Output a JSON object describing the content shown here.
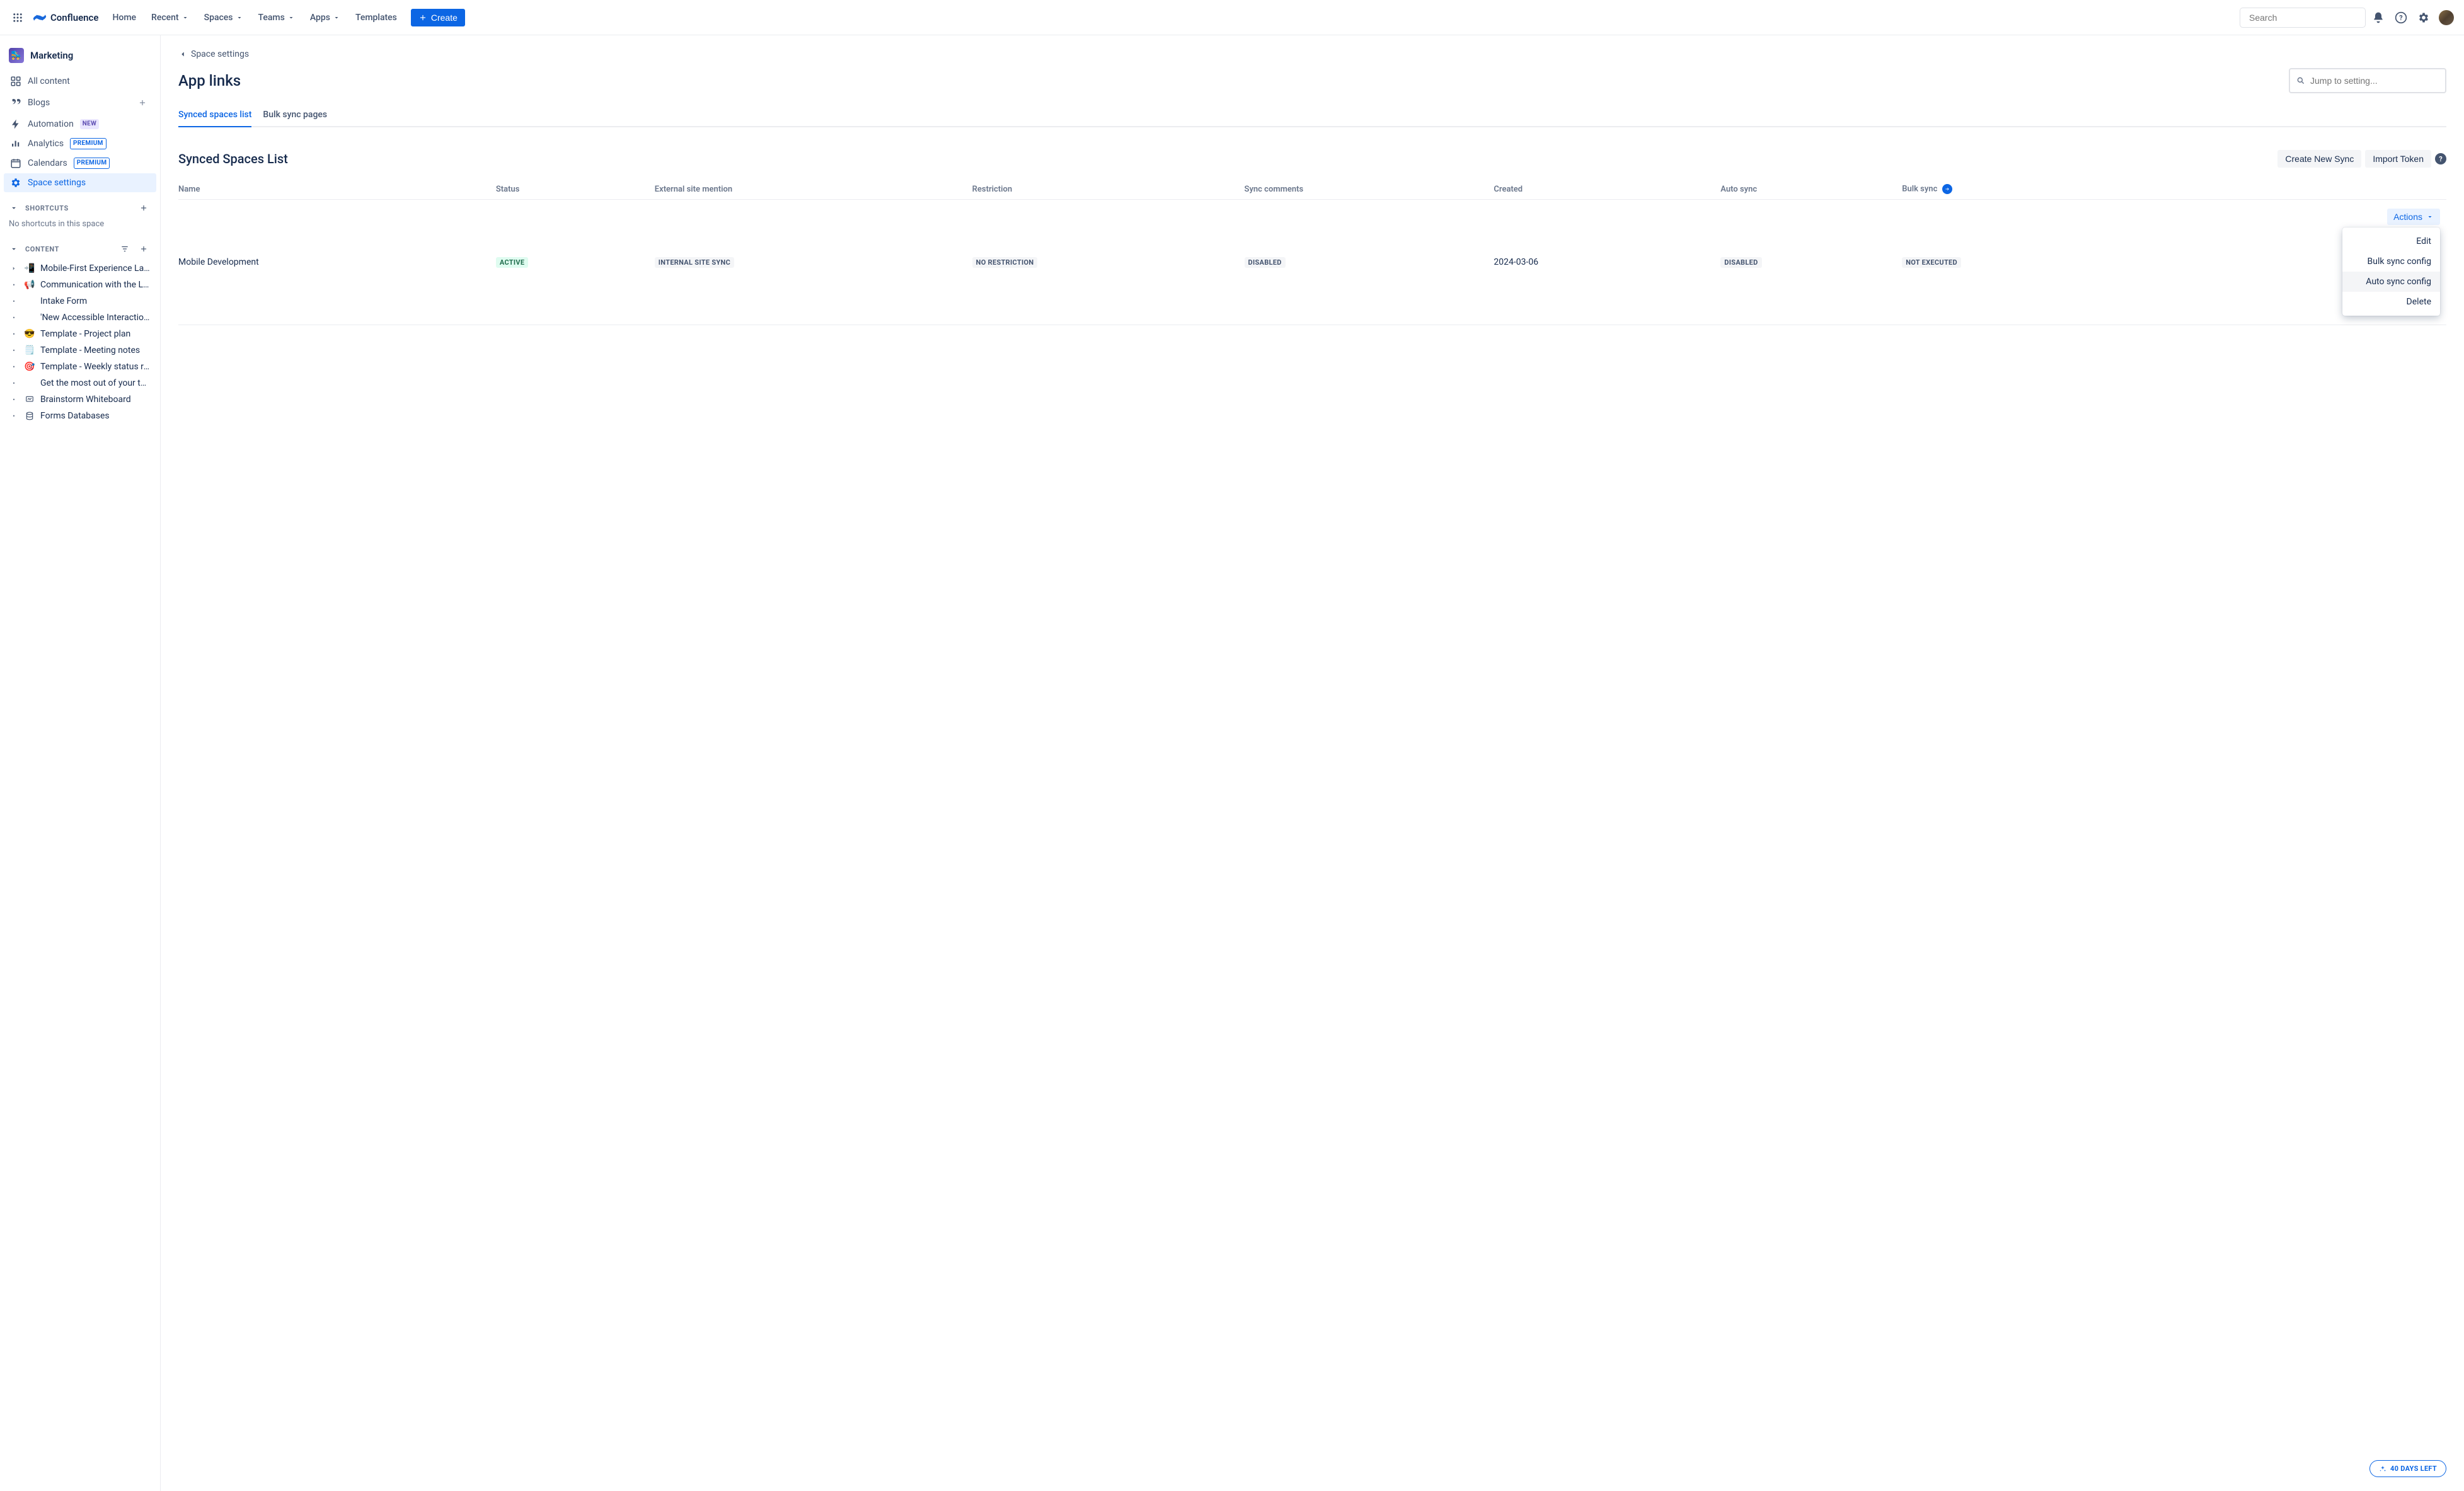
{
  "topnav": {
    "brand": "Confluence",
    "items": {
      "home": "Home",
      "recent": "Recent",
      "spaces": "Spaces",
      "teams": "Teams",
      "apps": "Apps",
      "templates": "Templates"
    },
    "create": "Create",
    "search_placeholder": "Search"
  },
  "sidebar": {
    "space_name": "Marketing",
    "nav": {
      "all_content": "All content",
      "blogs": "Blogs",
      "automation": "Automation",
      "automation_badge": "NEW",
      "analytics": "Analytics",
      "analytics_badge": "PREMIUM",
      "calendars": "Calendars",
      "calendars_badge": "PREMIUM",
      "space_settings": "Space settings"
    },
    "shortcuts_header": "SHORTCUTS",
    "shortcuts_empty": "No shortcuts in this space",
    "content_header": "CONTENT",
    "tree": [
      {
        "icon": "📲",
        "label": "Mobile-First Experience Launch - Project C...",
        "expander": ">"
      },
      {
        "icon": "📢",
        "label": "Communication with the Loop",
        "expander": "•"
      },
      {
        "icon": "",
        "label": "Intake Form",
        "expander": "•"
      },
      {
        "icon": "",
        "label": "'New Accessible Interaction Anytime App' mark...",
        "expander": "•"
      },
      {
        "icon": "😎",
        "label": "Template - Project plan",
        "expander": "•"
      },
      {
        "icon": "🗒️",
        "label": "Template - Meeting notes",
        "expander": "•"
      },
      {
        "icon": "🎯",
        "label": "Template - Weekly status report",
        "expander": "•"
      },
      {
        "icon": "",
        "label": "Get the most out of your team space",
        "expander": "•"
      },
      {
        "icon": "🔷",
        "label": "Brainstorm Whiteboard",
        "expander": "•",
        "svg": "whiteboard"
      },
      {
        "icon": "📋",
        "label": "Forms Databases",
        "expander": "•",
        "svg": "database"
      }
    ]
  },
  "breadcrumb": {
    "label": "Space settings"
  },
  "page": {
    "title": "App links",
    "jump_placeholder": "Jump to setting..."
  },
  "tabs": {
    "synced": "Synced spaces list",
    "bulk": "Bulk sync pages"
  },
  "section": {
    "title": "Synced Spaces List",
    "create_new_sync": "Create New Sync",
    "import_token": "Import Token"
  },
  "table": {
    "headers": {
      "name": "Name",
      "status": "Status",
      "external_site": "External site mention",
      "restriction": "Restriction",
      "sync_comments": "Sync comments",
      "created": "Created",
      "auto_sync": "Auto sync",
      "bulk_sync": "Bulk sync"
    },
    "rows": [
      {
        "name": "Mobile Development",
        "status": "ACTIVE",
        "external_site": "INTERNAL SITE SYNC",
        "restriction": "NO RESTRICTION",
        "sync_comments": "DISABLED",
        "created": "2024-03-06",
        "auto_sync": "DISABLED",
        "bulk_sync": "NOT EXECUTED",
        "actions_label": "Actions"
      }
    ]
  },
  "actions_menu": {
    "edit": "Edit",
    "bulk_sync_config": "Bulk sync config",
    "auto_sync_config": "Auto sync config",
    "delete": "Delete"
  },
  "trial": {
    "label": "40 DAYS LEFT"
  }
}
